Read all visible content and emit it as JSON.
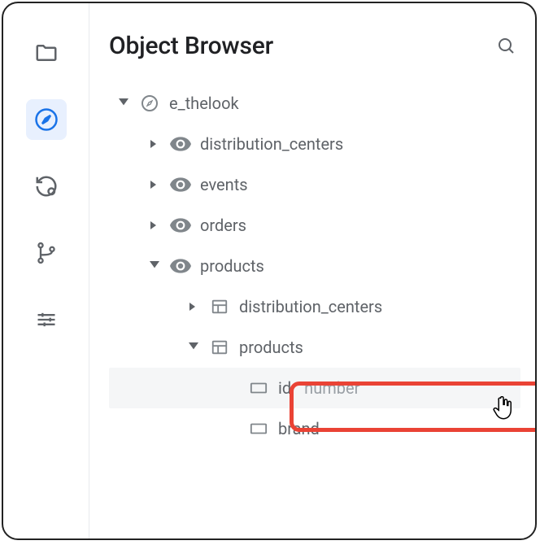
{
  "header": {
    "title": "Object Browser"
  },
  "sidebar": {
    "items": [
      {
        "name": "folder"
      },
      {
        "name": "compass"
      },
      {
        "name": "history"
      },
      {
        "name": "branch"
      },
      {
        "name": "tune"
      }
    ],
    "activeIndex": 1
  },
  "tree": {
    "root": {
      "label": "e_thelook",
      "children": [
        {
          "label": "distribution_centers"
        },
        {
          "label": "events"
        },
        {
          "label": "orders"
        },
        {
          "label": "products",
          "expanded": true,
          "children": [
            {
              "label": "distribution_centers"
            },
            {
              "label": "products",
              "expanded": true,
              "children": [
                {
                  "label": "id",
                  "type": "number",
                  "highlighted": true
                },
                {
                  "label": "brand"
                }
              ]
            }
          ]
        }
      ]
    }
  }
}
